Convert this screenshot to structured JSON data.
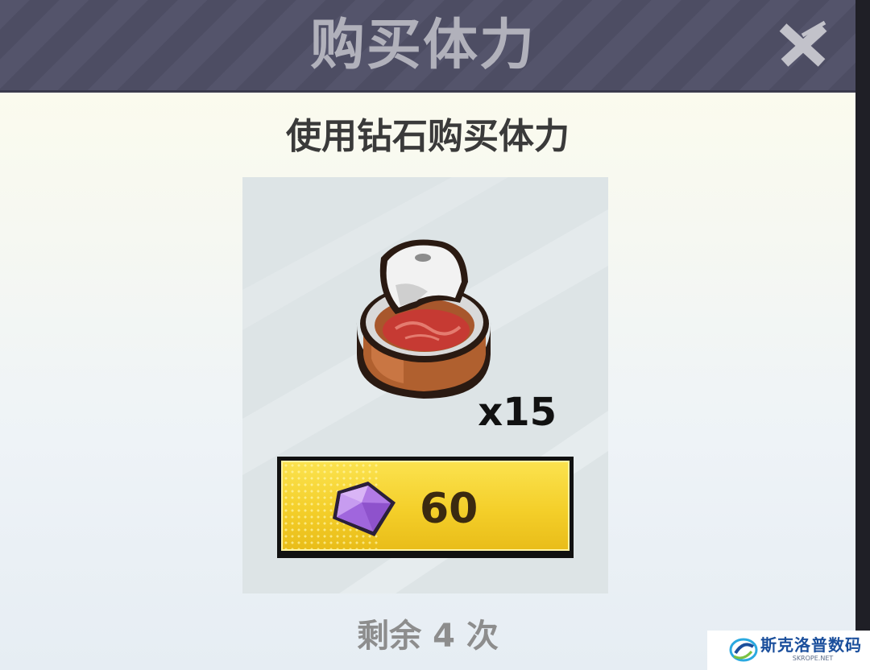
{
  "dialog": {
    "title": "购买体力",
    "subtitle": "使用钻石购买体力"
  },
  "item": {
    "icon": "canned-meat-icon",
    "quantity": "x15"
  },
  "purchase": {
    "currency_icon": "diamond-icon",
    "price": "60"
  },
  "remaining_text": "剩余 4 次",
  "watermark": {
    "name": "斯克洛普数码",
    "site": "SKROPE.NET"
  },
  "colors": {
    "header": "#54546b",
    "button": "#f4cf2a",
    "gem": "#b27be6"
  }
}
